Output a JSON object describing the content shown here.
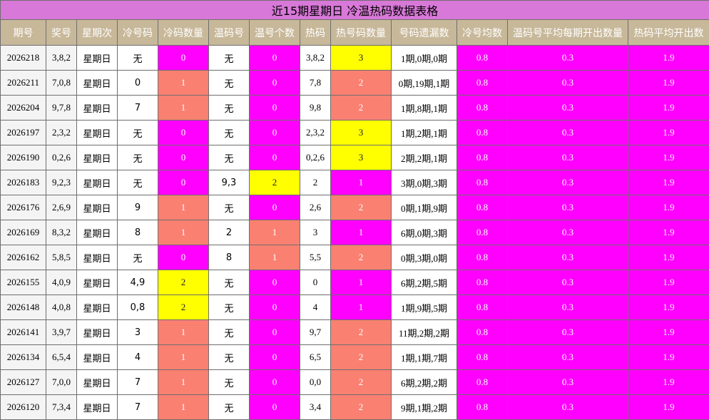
{
  "title": "近15期星期日 冷温热码数据表格",
  "colors": {
    "title_bg": "#d878d8",
    "header_bg": "#c8b89a",
    "zero_magenta": "#ff00ff",
    "one_salmon": "#fa8072",
    "two_yellow": "#ffff00",
    "avg_magenta": "#ff00ff"
  },
  "headers": [
    "期号",
    "奖号",
    "星期次",
    "冷号码",
    "冷码数量",
    "温码号",
    "温号个数",
    "热码",
    "热号码数量",
    "号码遗漏数",
    "冷号均数",
    "温码号平均每期开出数量",
    "热码平均开出数"
  ],
  "rows": [
    {
      "issue": "2026218",
      "draw": "3,8,2",
      "weekday": "星期日",
      "cold": "无",
      "cold_count": "0",
      "warm": "无",
      "warm_count": "0",
      "hot": "3,8,2",
      "hot_count": "3",
      "miss": "1期,0期,0期",
      "cold_avg": "0.8",
      "warm_avg": "0.3",
      "hot_avg": "1.9"
    },
    {
      "issue": "2026211",
      "draw": "7,0,8",
      "weekday": "星期日",
      "cold": "0",
      "cold_count": "1",
      "warm": "无",
      "warm_count": "0",
      "hot": "7,8",
      "hot_count": "2",
      "miss": "0期,19期,1期",
      "cold_avg": "0.8",
      "warm_avg": "0.3",
      "hot_avg": "1.9"
    },
    {
      "issue": "2026204",
      "draw": "9,7,8",
      "weekday": "星期日",
      "cold": "7",
      "cold_count": "1",
      "warm": "无",
      "warm_count": "0",
      "hot": "9,8",
      "hot_count": "2",
      "miss": "1期,8期,1期",
      "cold_avg": "0.8",
      "warm_avg": "0.3",
      "hot_avg": "1.9"
    },
    {
      "issue": "2026197",
      "draw": "2,3,2",
      "weekday": "星期日",
      "cold": "无",
      "cold_count": "0",
      "warm": "无",
      "warm_count": "0",
      "hot": "2,3,2",
      "hot_count": "3",
      "miss": "1期,2期,1期",
      "cold_avg": "0.8",
      "warm_avg": "0.3",
      "hot_avg": "1.9"
    },
    {
      "issue": "2026190",
      "draw": "0,2,6",
      "weekday": "星期日",
      "cold": "无",
      "cold_count": "0",
      "warm": "无",
      "warm_count": "0",
      "hot": "0,2,6",
      "hot_count": "3",
      "miss": "2期,2期,1期",
      "cold_avg": "0.8",
      "warm_avg": "0.3",
      "hot_avg": "1.9"
    },
    {
      "issue": "2026183",
      "draw": "9,2,3",
      "weekday": "星期日",
      "cold": "无",
      "cold_count": "0",
      "warm": "9,3",
      "warm_count": "2",
      "hot": "2",
      "hot_count": "1",
      "miss": "3期,0期,3期",
      "cold_avg": "0.8",
      "warm_avg": "0.3",
      "hot_avg": "1.9"
    },
    {
      "issue": "2026176",
      "draw": "2,6,9",
      "weekday": "星期日",
      "cold": "9",
      "cold_count": "1",
      "warm": "无",
      "warm_count": "0",
      "hot": "2,6",
      "hot_count": "2",
      "miss": "0期,1期,9期",
      "cold_avg": "0.8",
      "warm_avg": "0.3",
      "hot_avg": "1.9"
    },
    {
      "issue": "2026169",
      "draw": "8,3,2",
      "weekday": "星期日",
      "cold": "8",
      "cold_count": "1",
      "warm": "2",
      "warm_count": "1",
      "hot": "3",
      "hot_count": "1",
      "miss": "6期,0期,3期",
      "cold_avg": "0.8",
      "warm_avg": "0.3",
      "hot_avg": "1.9"
    },
    {
      "issue": "2026162",
      "draw": "5,8,5",
      "weekday": "星期日",
      "cold": "无",
      "cold_count": "0",
      "warm": "8",
      "warm_count": "1",
      "hot": "5,5",
      "hot_count": "2",
      "miss": "0期,3期,0期",
      "cold_avg": "0.8",
      "warm_avg": "0.3",
      "hot_avg": "1.9"
    },
    {
      "issue": "2026155",
      "draw": "4,0,9",
      "weekday": "星期日",
      "cold": "4,9",
      "cold_count": "2",
      "warm": "无",
      "warm_count": "0",
      "hot": "0",
      "hot_count": "1",
      "miss": "6期,2期,5期",
      "cold_avg": "0.8",
      "warm_avg": "0.3",
      "hot_avg": "1.9"
    },
    {
      "issue": "2026148",
      "draw": "4,0,8",
      "weekday": "星期日",
      "cold": "0,8",
      "cold_count": "2",
      "warm": "无",
      "warm_count": "0",
      "hot": "4",
      "hot_count": "1",
      "miss": "1期,9期,5期",
      "cold_avg": "0.8",
      "warm_avg": "0.3",
      "hot_avg": "1.9"
    },
    {
      "issue": "2026141",
      "draw": "3,9,7",
      "weekday": "星期日",
      "cold": "3",
      "cold_count": "1",
      "warm": "无",
      "warm_count": "0",
      "hot": "9,7",
      "hot_count": "2",
      "miss": "11期,2期,2期",
      "cold_avg": "0.8",
      "warm_avg": "0.3",
      "hot_avg": "1.9"
    },
    {
      "issue": "2026134",
      "draw": "6,5,4",
      "weekday": "星期日",
      "cold": "4",
      "cold_count": "1",
      "warm": "无",
      "warm_count": "0",
      "hot": "6,5",
      "hot_count": "2",
      "miss": "1期,1期,7期",
      "cold_avg": "0.8",
      "warm_avg": "0.3",
      "hot_avg": "1.9"
    },
    {
      "issue": "2026127",
      "draw": "7,0,0",
      "weekday": "星期日",
      "cold": "7",
      "cold_count": "1",
      "warm": "无",
      "warm_count": "0",
      "hot": "0,0",
      "hot_count": "2",
      "miss": "6期,2期,2期",
      "cold_avg": "0.8",
      "warm_avg": "0.3",
      "hot_avg": "1.9"
    },
    {
      "issue": "2026120",
      "draw": "7,3,4",
      "weekday": "星期日",
      "cold": "7",
      "cold_count": "1",
      "warm": "无",
      "warm_count": "0",
      "hot": "3,4",
      "hot_count": "2",
      "miss": "9期,1期,2期",
      "cold_avg": "0.8",
      "warm_avg": "0.3",
      "hot_avg": "1.9"
    }
  ]
}
